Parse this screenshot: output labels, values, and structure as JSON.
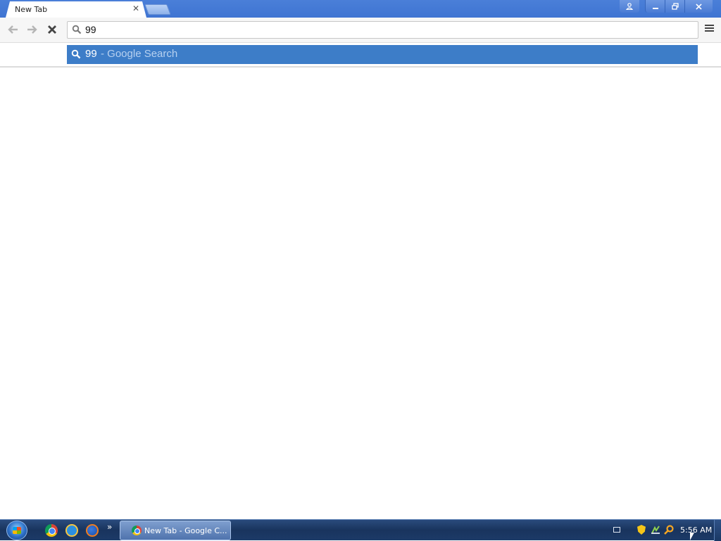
{
  "browser": {
    "tab": {
      "title": "New Tab",
      "close_glyph": "✕"
    },
    "window_buttons": {
      "profile_icon": "profile-icon",
      "minimize": "minimize-icon",
      "restore": "restore-icon",
      "close": "close-icon"
    },
    "omnibox": {
      "value": "99",
      "icon": "search-icon"
    },
    "suggestion": {
      "query": "99",
      "separator_text": " - Google Search",
      "icon": "search-icon"
    },
    "colors": {
      "frame": "#3f74d2",
      "suggestion_highlight": "#3d7dc8"
    }
  },
  "taskbar": {
    "quick_launch": [
      "chrome-icon",
      "internet-explorer-icon",
      "firefox-icon"
    ],
    "more_glyph": "»",
    "task_button": {
      "label": "New Tab - Google C..."
    },
    "clock": "5:56 AM"
  }
}
